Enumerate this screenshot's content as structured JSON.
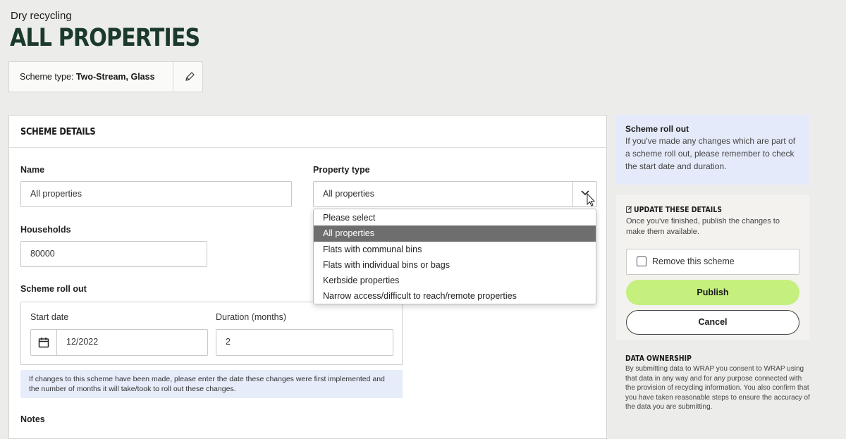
{
  "page": {
    "subtitle": "Dry recycling",
    "title": "ALL PROPERTIES"
  },
  "scheme_type": {
    "label": "Scheme type:",
    "value": "Two-Stream, Glass",
    "edit_icon": "pencil-icon"
  },
  "details": {
    "heading": "SCHEME DETAILS",
    "name_label": "Name",
    "name_value": "All properties",
    "property_type_label": "Property type",
    "property_type_value": "All properties",
    "households_label": "Households",
    "households_value": "80000",
    "rollout_label": "Scheme roll out",
    "start_date_label": "Start date",
    "start_date_value": "12/2022",
    "duration_label": "Duration (months)",
    "duration_value": "2",
    "hint": "If changes to this scheme have been made, please enter the date these changes were first implemented and the number of months it will take/took to roll out these changes.",
    "notes_label": "Notes"
  },
  "dropdown": {
    "options": [
      "Please select",
      "All properties",
      "Flats with communal bins",
      "Flats with individual bins or bags",
      "Kerbside properties",
      "Narrow access/difficult to reach/remote properties"
    ],
    "selected_index": 1
  },
  "rollout_panel": {
    "title": "Scheme roll out",
    "text": "If you've made any changes which are part of a scheme roll out, please remember to check the start date and duration."
  },
  "update_panel": {
    "title": "UPDATE THESE DETAILS",
    "text": "Once you've finished, publish the changes to make them available.",
    "remove_label": "Remove this scheme",
    "publish_label": "Publish",
    "cancel_label": "Cancel"
  },
  "ownership": {
    "title": "DATA OWNERSHIP",
    "text": "By submitting data to WRAP you consent to WRAP using that data in any way and for any purpose connected with the provision of recycling information. You also confirm that you have taken reasonable steps to ensure the accuracy of the data you are submitting."
  },
  "colors": {
    "background": "#ecedea",
    "title": "#1b3a2c",
    "publish": "#c5f07e",
    "info_panel": "#e4eaf9",
    "selected_option": "#6e6e6e"
  }
}
